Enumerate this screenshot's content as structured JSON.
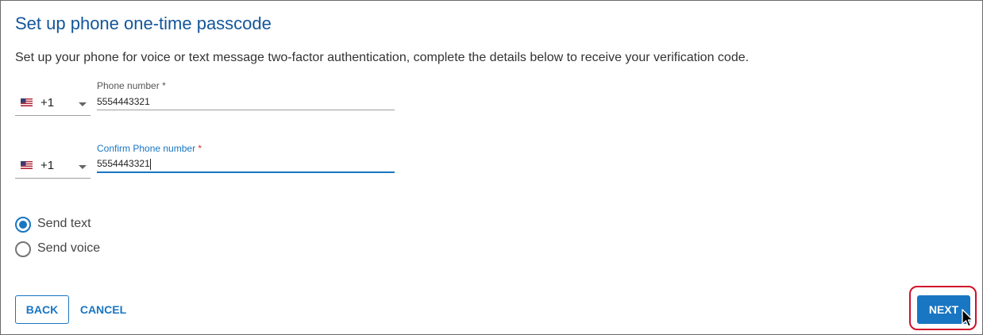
{
  "page": {
    "title": "Set up phone one-time passcode",
    "description": "Set up your phone for voice or text message two-factor authentication, complete the details below to receive your verification code."
  },
  "phone": {
    "country_flag": "us-flag-icon",
    "country_code": "+1",
    "label": "Phone number",
    "required_mark": "*",
    "value": "5554443321"
  },
  "confirm_phone": {
    "country_flag": "us-flag-icon",
    "country_code": "+1",
    "label": "Confirm Phone number",
    "required_mark": "*",
    "value": "5554443321"
  },
  "delivery": {
    "options": [
      {
        "label": "Send text",
        "checked": true
      },
      {
        "label": "Send voice",
        "checked": false
      }
    ]
  },
  "actions": {
    "back_label": "BACK",
    "cancel_label": "CANCEL",
    "next_label": "NEXT"
  },
  "colors": {
    "accent": "#1976c2",
    "title": "#13569a",
    "highlight": "#d0102a",
    "required": "#d32f2f"
  }
}
